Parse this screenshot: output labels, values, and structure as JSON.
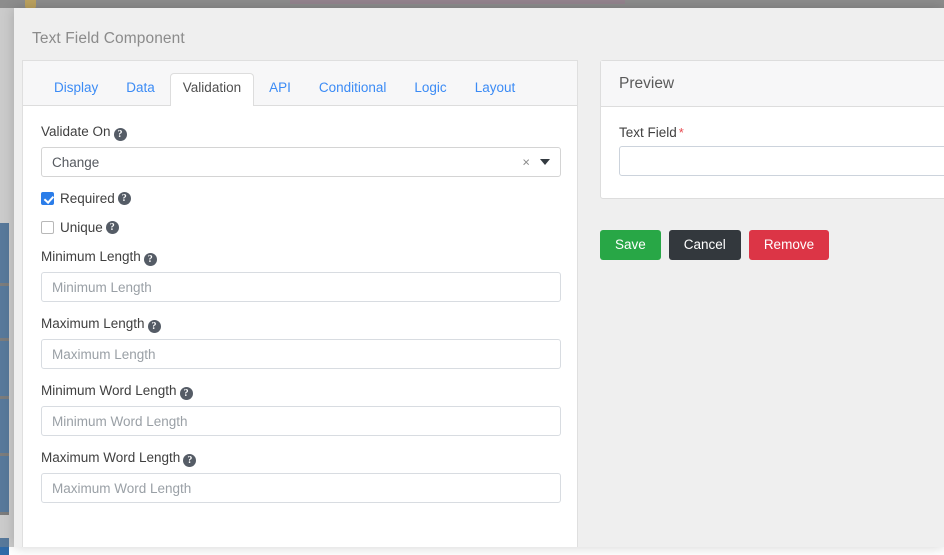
{
  "background": {
    "topbar_accent_color": "#9b7f91",
    "rail_color": "#2f6aa8"
  },
  "modal": {
    "title": "Text Field Component",
    "tabs": [
      {
        "label": "Display",
        "active": false
      },
      {
        "label": "Data",
        "active": false
      },
      {
        "label": "Validation",
        "active": true
      },
      {
        "label": "API",
        "active": false
      },
      {
        "label": "Conditional",
        "active": false
      },
      {
        "label": "Logic",
        "active": false
      },
      {
        "label": "Layout",
        "active": false
      }
    ]
  },
  "validation": {
    "validate_on": {
      "label": "Validate On",
      "value": "Change",
      "clear_icon": "×",
      "help_icon": "?"
    },
    "required": {
      "label": "Required",
      "checked": true,
      "help_icon": "?"
    },
    "unique": {
      "label": "Unique",
      "checked": false,
      "help_icon": "?"
    },
    "minimum_length": {
      "label": "Minimum Length",
      "placeholder": "Minimum Length",
      "value": "",
      "help_icon": "?"
    },
    "maximum_length": {
      "label": "Maximum Length",
      "placeholder": "Maximum Length",
      "value": "",
      "help_icon": "?"
    },
    "minimum_word_length": {
      "label": "Minimum Word Length",
      "placeholder": "Minimum Word Length",
      "value": "",
      "help_icon": "?"
    },
    "maximum_word_length": {
      "label": "Maximum Word Length",
      "placeholder": "Maximum Word Length",
      "value": "",
      "help_icon": "?"
    }
  },
  "preview": {
    "header": "Preview",
    "field_label": "Text Field",
    "required_marker": "*",
    "field_value": "",
    "field_placeholder": ""
  },
  "actions": {
    "save": {
      "label": "Save",
      "color": "#28a746"
    },
    "cancel": {
      "label": "Cancel",
      "color": "#33383d"
    },
    "remove": {
      "label": "Remove",
      "color": "#dc3546"
    }
  }
}
